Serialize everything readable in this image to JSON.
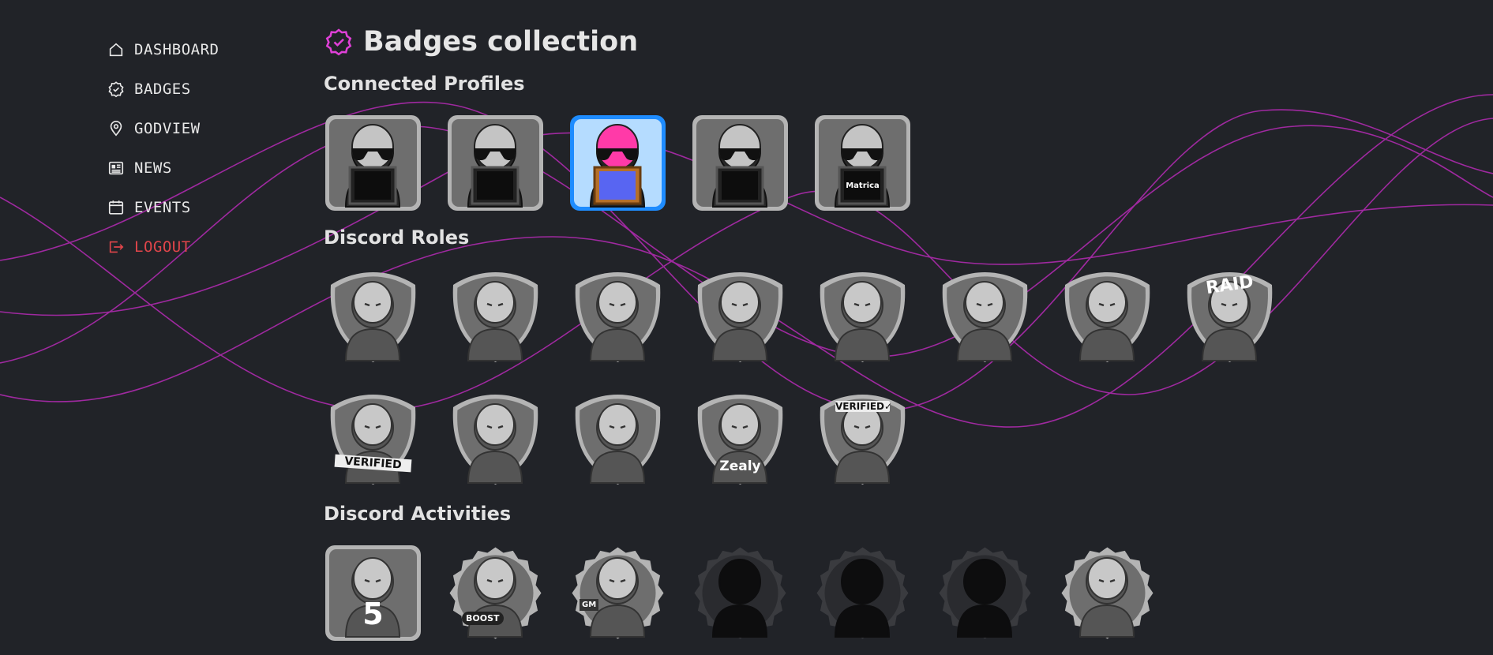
{
  "colors": {
    "background": "#212328",
    "accent": "#e040d8",
    "logout": "#e0454a",
    "selected": "#1e8cff"
  },
  "nav": [
    {
      "id": "dashboard",
      "label": "DASHBOARD",
      "icon": "home-icon"
    },
    {
      "id": "badges",
      "label": "BADGES",
      "icon": "badge-check-icon"
    },
    {
      "id": "godview",
      "label": "GODVIEW",
      "icon": "map-pin-icon"
    },
    {
      "id": "news",
      "label": "NEWS",
      "icon": "newspaper-icon"
    },
    {
      "id": "events",
      "label": "EVENTS",
      "icon": "calendar-icon"
    },
    {
      "id": "logout",
      "label": "LOGOUT",
      "icon": "logout-icon"
    }
  ],
  "page": {
    "title": "Badges collection",
    "title_icon": "badge-check-icon"
  },
  "sections": {
    "connected_profiles": {
      "title": "Connected Profiles",
      "badges": [
        {
          "name": "x-profile-badge",
          "icon": "x-logo-icon",
          "active": false
        },
        {
          "name": "telegram-profile-badge",
          "icon": "telegram-logo-icon",
          "active": false
        },
        {
          "name": "discord-profile-badge",
          "icon": "discord-logo-icon",
          "active": true
        },
        {
          "name": "p-profile-badge",
          "icon": "p-logo-icon",
          "active": false
        },
        {
          "name": "matrica-profile-badge",
          "icon": "matrica-logo-icon",
          "label": "Matrica",
          "active": false
        }
      ]
    },
    "discord_roles": {
      "title": "Discord Roles",
      "badges": [
        {
          "name": "builder-role-badge",
          "icon": "builder-icon"
        },
        {
          "name": "astronaut-role-badge",
          "icon": "astronaut-icon"
        },
        {
          "name": "galactic-role-badge",
          "icon": "spacesuit-icon"
        },
        {
          "name": "gangster-role-badge",
          "icon": "gangster-icon"
        },
        {
          "name": "swing-role-badge",
          "icon": "swing-icon"
        },
        {
          "name": "influencer-role-badge",
          "icon": "selfie-girl-icon"
        },
        {
          "name": "social-role-badge",
          "icon": "phone-guy-icon"
        },
        {
          "name": "raid-role-badge",
          "icon": "raid-icon",
          "label": "RAID"
        },
        {
          "name": "bomb-squad-verified-badge",
          "icon": "bomb-suit-icon",
          "label": "VERIFIED"
        },
        {
          "name": "sword-role-badge",
          "icon": "sword-icon"
        },
        {
          "name": "peaky-role-badge",
          "icon": "flat-cap-icon"
        },
        {
          "name": "zealy-role-badge",
          "icon": "racer-icon",
          "label": "Zealy"
        },
        {
          "name": "verified-sign-badge",
          "icon": "sign-holder-icon",
          "label": "VERIFIED✓"
        }
      ]
    },
    "discord_activities": {
      "title": "Discord Activities",
      "badges": [
        {
          "name": "level-5-badge",
          "icon": "number-five-icon",
          "label": "5",
          "locked": false
        },
        {
          "name": "boost-badge",
          "icon": "boost-icon",
          "label": "BOOST",
          "locked": false
        },
        {
          "name": "gm-badge",
          "icon": "gm-mug-icon",
          "label": "GM",
          "locked": false
        },
        {
          "name": "locked-activity-badge-1",
          "icon": "silhouette-icon",
          "locked": true
        },
        {
          "name": "locked-activity-badge-2",
          "icon": "silhouette-icon",
          "locked": true
        },
        {
          "name": "locked-activity-badge-3",
          "icon": "silhouette-icon",
          "locked": true
        },
        {
          "name": "laptop-badge",
          "icon": "laptop-icon",
          "locked": false
        }
      ]
    }
  }
}
